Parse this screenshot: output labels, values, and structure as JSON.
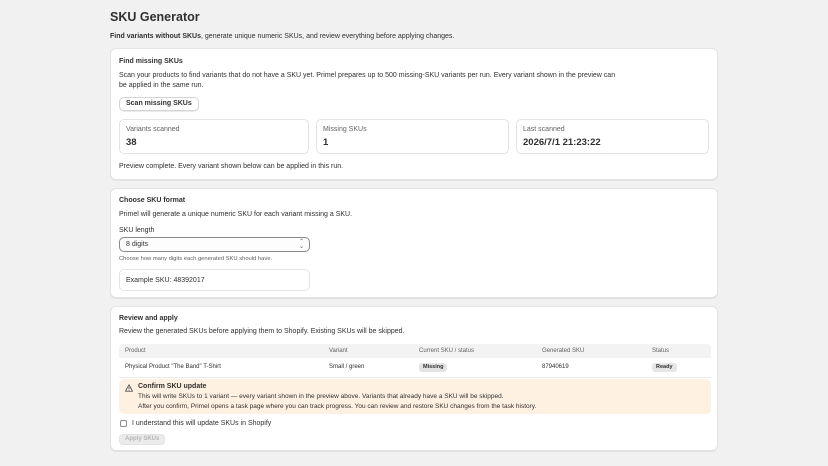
{
  "page": {
    "title": "SKU Generator",
    "subtitle_bold": "Find variants without SKUs",
    "subtitle_rest": ", generate unique numeric SKUs, and review everything before applying changes."
  },
  "find": {
    "title": "Find missing SKUs",
    "desc_line1": "Scan your products to find variants that do not have a SKU yet. Primel prepares up to 500 missing-SKU variants per run. Every variant shown in the preview can",
    "desc_line2": "be applied in the same run.",
    "scan_button": "Scan missing SKUs",
    "stats": [
      {
        "label": "Variants scanned",
        "value": "38"
      },
      {
        "label": "Missing SKUs",
        "value": "1"
      },
      {
        "label": "Last scanned",
        "value": "2026/7/1 21:23:22"
      }
    ],
    "status": "Preview complete. Every variant shown below can be applied in this run."
  },
  "format": {
    "title": "Choose SKU format",
    "desc": "Primel will generate a unique numeric SKU for each variant missing a SKU.",
    "length_label": "SKU length",
    "length_value": "8 digits",
    "help": "Choose how many digits each generated SKU should have.",
    "example": "Example SKU: 48392017"
  },
  "review": {
    "title": "Review and apply",
    "desc": "Review the generated SKUs before applying them to Shopify. Existing SKUs will be skipped.",
    "columns": [
      "Product",
      "Variant",
      "Current SKU / status",
      "Generated SKU",
      "Status"
    ],
    "rows": [
      {
        "product": "Physical Product \"The Band\" T-Shirt",
        "variant": "Small / green",
        "current": "Missing",
        "generated": "87940619",
        "status": "Ready"
      }
    ],
    "banner": {
      "title": "Confirm SKU update",
      "line1": "This will write SKUs to 1 variant — every variant shown in the preview above. Variants that already have a SKU will be skipped.",
      "line2": "After you confirm, Primel opens a task page where you can track progress. You can review and restore SKU changes from the task history."
    },
    "checkbox_label": "I understand this will update SKUs in Shopify",
    "apply_button": "Apply SKUs"
  },
  "icons": {
    "select": "chevron-up-down-icon",
    "banner": "warning-triangle-icon"
  },
  "colors": {
    "background": "#f1f1f1",
    "card": "#ffffff",
    "banner": "#fef1e2"
  }
}
